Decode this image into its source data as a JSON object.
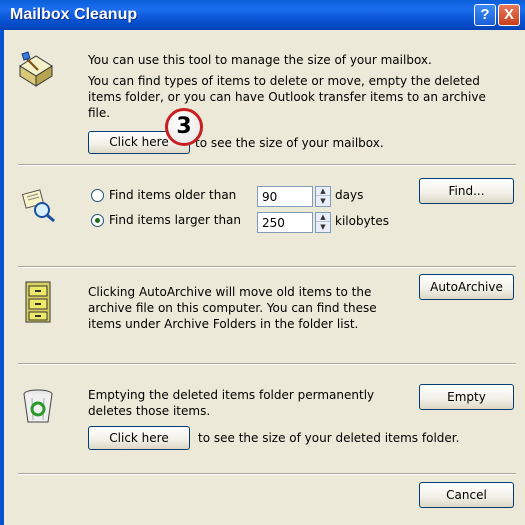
{
  "window": {
    "title": "Mailbox Cleanup",
    "help_label": "?",
    "close_label": "X"
  },
  "size_section": {
    "intro": "You can use this tool to manage the size of your mailbox.",
    "desc_line1": "You can find types of items to delete or move, empty the deleted",
    "desc_line2": "items folder, or you can have Outlook transfer items to an archive",
    "desc_line3": "file.",
    "button": "Click here",
    "suffix": "to see the size of your mailbox.",
    "icon": "mailbox-broom-icon"
  },
  "find_section": {
    "older_label": "Find items older than",
    "older_value": "90",
    "older_unit": "days",
    "larger_label": "Find items larger than",
    "larger_value": "250",
    "larger_unit": "kilobytes",
    "selected": "larger",
    "find_button": "Find...",
    "icon": "find-magnifier-icon"
  },
  "archive_section": {
    "line1": "Clicking AutoArchive will move old items to the",
    "line2": "archive file on this computer.  You can find these",
    "line3": "items under Archive Folders in the folder list.",
    "button": "AutoArchive",
    "icon": "file-cabinet-icon"
  },
  "deleted_section": {
    "line1": "Emptying the deleted items folder permanently",
    "line2": "deletes those items.",
    "empty_button": "Empty",
    "button": "Click here",
    "suffix": "to see the size of your deleted items folder.",
    "icon": "recycle-bin-icon"
  },
  "footer": {
    "cancel_button": "Cancel"
  },
  "annotation": {
    "step_number": "3"
  },
  "colors": {
    "titlebar": "#0752d0",
    "dialog_bg": "#ece9d8",
    "annotation_border": "#c82020"
  }
}
